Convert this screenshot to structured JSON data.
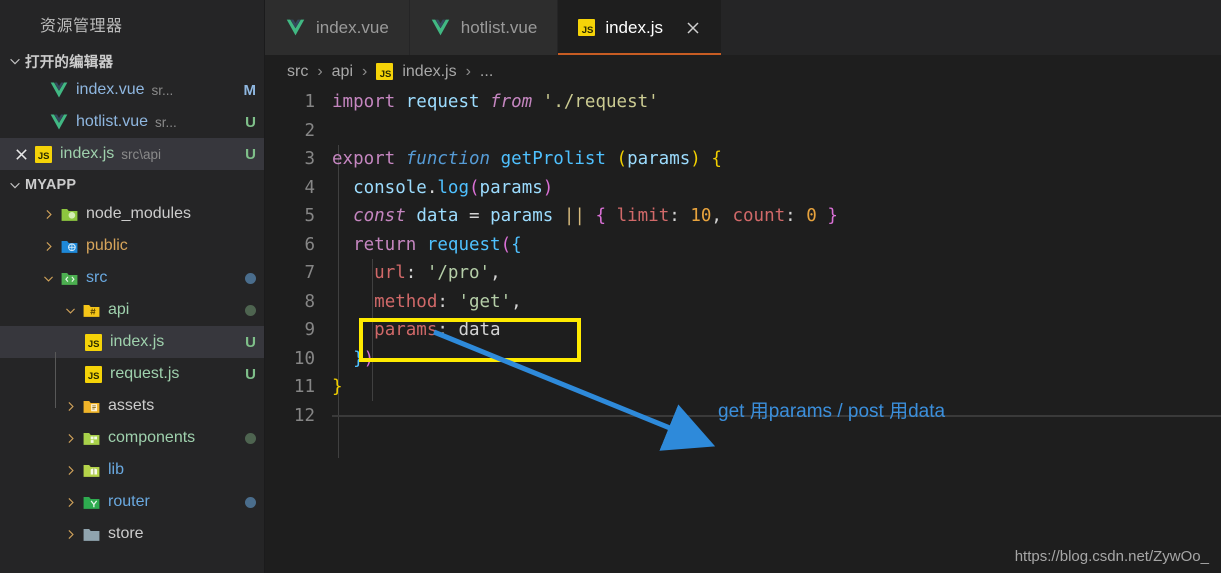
{
  "sidebar": {
    "title": "资源管理器",
    "sections": [
      {
        "label": "打开的编辑器"
      },
      {
        "label": "MYAPP"
      }
    ],
    "open_editors": [
      {
        "name": "index.vue",
        "desc": "sr...",
        "badge": "M",
        "icon": "vue-icon",
        "has_close": false,
        "selected": false
      },
      {
        "name": "hotlist.vue",
        "desc": "sr...",
        "badge": "U",
        "icon": "vue-icon",
        "has_close": false,
        "selected": false
      },
      {
        "name": "index.js",
        "desc": "src\\api",
        "badge": "U",
        "icon": "js-icon",
        "has_close": true,
        "selected": true
      }
    ],
    "tree": [
      {
        "name": "node_modules",
        "icon": "folder-node-icon",
        "twisty": "chevron-right-icon",
        "depth": 1,
        "badge": "",
        "dot": "",
        "selected": false
      },
      {
        "name": "public",
        "icon": "folder-public-icon",
        "twisty": "chevron-right-icon",
        "depth": 1,
        "badge": "",
        "dot": "",
        "selected": false
      },
      {
        "name": "src",
        "icon": "folder-src-icon",
        "twisty": "chevron-down-icon",
        "depth": 1,
        "badge": "",
        "dot": "#4a6d8c",
        "selected": false
      },
      {
        "name": "api",
        "icon": "folder-api-icon",
        "twisty": "chevron-down-icon",
        "depth": 2,
        "badge": "",
        "dot": "#4e6450",
        "selected": false
      },
      {
        "name": "index.js",
        "icon": "js-icon",
        "twisty": "",
        "depth": 3,
        "badge": "U",
        "dot": "",
        "selected": true
      },
      {
        "name": "request.js",
        "icon": "js-icon",
        "twisty": "",
        "depth": 3,
        "badge": "U",
        "dot": "",
        "selected": false
      },
      {
        "name": "assets",
        "icon": "folder-assets-icon",
        "twisty": "chevron-right-icon",
        "depth": 2,
        "badge": "",
        "dot": "",
        "selected": false
      },
      {
        "name": "components",
        "icon": "folder-components-icon",
        "twisty": "chevron-right-icon",
        "depth": 2,
        "badge": "",
        "dot": "#4e6450",
        "selected": false
      },
      {
        "name": "lib",
        "icon": "folder-lib-icon",
        "twisty": "chevron-right-icon",
        "depth": 2,
        "badge": "",
        "dot": "",
        "selected": false
      },
      {
        "name": "router",
        "icon": "folder-router-icon",
        "twisty": "chevron-right-icon",
        "depth": 2,
        "badge": "",
        "dot": "#4a6d8c",
        "selected": false
      },
      {
        "name": "store",
        "icon": "folder-plain-icon",
        "twisty": "chevron-right-icon",
        "depth": 2,
        "badge": "",
        "dot": "",
        "selected": false
      }
    ]
  },
  "tabs": [
    {
      "label": "index.vue",
      "icon": "vue-icon",
      "active": false,
      "closable": false
    },
    {
      "label": "hotlist.vue",
      "icon": "vue-icon",
      "active": false,
      "closable": false
    },
    {
      "label": "index.js",
      "icon": "js-icon",
      "active": true,
      "closable": true
    }
  ],
  "breadcrumb": {
    "items": [
      "src",
      "api",
      "index.js",
      "..."
    ],
    "separator": "›"
  },
  "editor": {
    "current_line": 12,
    "lines": [
      {
        "n": "1",
        "text": "import request from './request'"
      },
      {
        "n": "2",
        "text": ""
      },
      {
        "n": "3",
        "text": "export function getProlist (params) {"
      },
      {
        "n": "4",
        "text": "  console.log(params)"
      },
      {
        "n": "5",
        "text": "  const data = params || { limit: 10, count: 0 }"
      },
      {
        "n": "6",
        "text": "  return request({"
      },
      {
        "n": "7",
        "text": "    url: '/pro',"
      },
      {
        "n": "8",
        "text": "    method: 'get',"
      },
      {
        "n": "9",
        "text": "    params: data"
      },
      {
        "n": "10",
        "text": "  })"
      },
      {
        "n": "11",
        "text": "}"
      },
      {
        "n": "12",
        "text": ""
      }
    ]
  },
  "annotations": {
    "note": "get 用params / post 用data",
    "highlight_color": "#ffeb00",
    "arrow_color": "#3b8fdc"
  },
  "watermark": "https://blog.csdn.net/ZywOo_"
}
